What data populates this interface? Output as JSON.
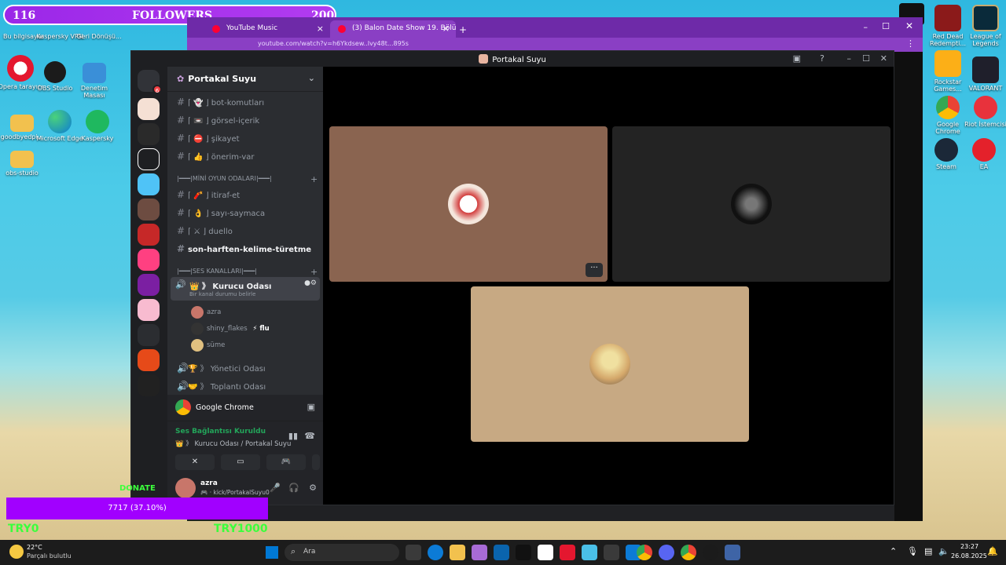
{
  "overlay": {
    "followers_current": "116",
    "followers_label": "FOLLOWERS",
    "followers_goal": "200",
    "donate_label": "DONATE",
    "donate_value": "7717 (37.10%)",
    "donate_min": "TRY0",
    "donate_max": "TRY1000"
  },
  "desktop": {
    "left_icons": [
      {
        "label": "Bu bilgisayar",
        "icon": "this-pc-icon"
      },
      {
        "label": "Kaspersky VPN",
        "icon": "kaspersky-vpn-icon"
      },
      {
        "label": "Geri Dönüşü...",
        "icon": "recycle-bin-icon"
      },
      {
        "label": "Opera tarayıcı",
        "icon": "opera-icon"
      },
      {
        "label": "OBS Studio",
        "icon": "obs-icon"
      },
      {
        "label": "Denetim Masası",
        "icon": "control-panel-icon"
      },
      {
        "label": "goodbyedpi...",
        "icon": "folder-icon"
      },
      {
        "label": "Microsoft Edge",
        "icon": "edge-icon"
      },
      {
        "label": "Kaspersky",
        "icon": "kaspersky-icon"
      },
      {
        "label": "obs-studio",
        "icon": "folder-icon"
      }
    ],
    "right_icons": [
      {
        "label": "Red Dead Redempti...",
        "icon": "rdr-icon"
      },
      {
        "label": "League of Legends",
        "icon": "lol-icon"
      },
      {
        "label": "Rockstar Games...",
        "icon": "rockstar-icon"
      },
      {
        "label": "VALORANT",
        "icon": "valorant-icon"
      },
      {
        "label": "Google Chrome",
        "icon": "chrome-icon"
      },
      {
        "label": "Riot İstemcisi",
        "icon": "riot-icon"
      },
      {
        "label": "Steam",
        "icon": "steam-icon"
      },
      {
        "label": "EA",
        "icon": "ea-icon"
      }
    ]
  },
  "browser": {
    "tabs": [
      {
        "title": "YouTube Music"
      },
      {
        "title": "(3) Balon Date Show 19. Bölüm"
      }
    ],
    "new_tab": "+",
    "address": "youtube.com/watch?v=h6Ykdsew..Ivy48t...895s"
  },
  "discord": {
    "window_title": "Portakal Suyu",
    "server_name": "Portakal Suyu",
    "home_badge": "6",
    "channels": [
      {
        "label": "⌈ 👻 ⌋  bot-komutları"
      },
      {
        "label": "⌈ 📼 ⌋  görsel-içerik"
      },
      {
        "label": "⌈ ⛔ ⌋  şikayet"
      },
      {
        "label": "⌈ 👍 ⌋  önerim-var"
      }
    ],
    "category_games": "|━━━|MİNİ OYUN ODALARI|━━━|",
    "game_channels": [
      {
        "label": "⌈ 🧨 ⌋  itiraf-et"
      },
      {
        "label": "⌈ 👌 ⌋  sayı-saymaca"
      },
      {
        "label": "⌈ ⚔ ⌋  duello"
      }
    ],
    "active_channel": "son-harften-kelime-türetme",
    "category_voice": "|━━━|SES KANALLARI|━━━|",
    "voice_channel": "👑 》 Kurucu Odası",
    "voice_status": "Bir kanal durumu belirle",
    "voice_users": [
      {
        "name": "azra"
      },
      {
        "name": "shiny_flakes"
      },
      {
        "name": "süme"
      }
    ],
    "voice_user_tag": "⚡ flu",
    "other_voice": [
      {
        "label": "🏆 》 Yönetici Odası"
      },
      {
        "label": "🤝 》 Toplantı Odası"
      }
    ],
    "stream_app": "Google Chrome",
    "connection_status": "Ses Bağlantısı Kuruldu",
    "connection_channel": "👑 》 Kurucu Odası / Portakal Suyu",
    "user_name": "azra",
    "user_status": "🎮 · kick/PortakalSuyu0",
    "tile_colors": [
      "#8a6450",
      "#232323",
      "#c7a983"
    ]
  },
  "taskbar": {
    "weather_temp": "22°C",
    "weather_desc": "Parçalı bulutlu",
    "search_placeholder": "Ara",
    "time": "23:27",
    "date": "26.08.2025"
  }
}
